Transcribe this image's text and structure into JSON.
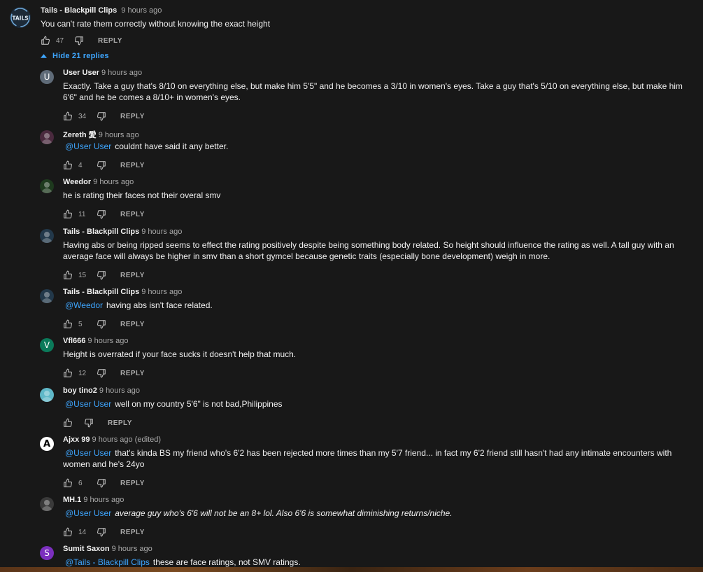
{
  "top_comment": {
    "author": "Tails - Blackpill Clips",
    "time": "9 hours ago",
    "text": "You can't rate them correctly without knowing the exact height",
    "likes": "47",
    "reply_label": "REPLY"
  },
  "hide_replies_label": "Hide 21 replies",
  "replies": [
    {
      "author": "User User",
      "time": "9 hours ago",
      "avatar_letter": "U",
      "avatar_color": "#5f6b78",
      "mention": "",
      "text": "Exactly. Take a guy that's 8/10 on everything else, but make him 5'5\" and he becomes a 3/10 in women's eyes. Take a guy that's 5/10 on everything else, but make him 6'6\" and he be comes a 8/10+ in women's eyes.",
      "likes": "34",
      "reply_label": "REPLY"
    },
    {
      "author": "Zereth 愛",
      "time": "9 hours ago",
      "avatar_letter": "",
      "avatar_color": "#4a2a3e",
      "mention": "@User User",
      "text": "couldnt have said it any better.",
      "likes": "4",
      "reply_label": "REPLY"
    },
    {
      "author": "Weedor",
      "time": "9 hours ago",
      "avatar_letter": "",
      "avatar_color": "#1e3a1e",
      "mention": "",
      "text": "he is rating their faces not their overal smv",
      "likes": "11",
      "reply_label": "REPLY"
    },
    {
      "author": "Tails - Blackpill Clips",
      "time": "9 hours ago",
      "avatar_letter": "",
      "avatar_color": "#22384a",
      "mention": "",
      "text": "Having abs or being ripped seems to effect the rating positively despite being something body related. So height should influence the rating as well. A tall guy with an average face will always be higher in smv than a short gymcel because genetic traits (especially bone development) weigh in more.",
      "likes": "15",
      "reply_label": "REPLY"
    },
    {
      "author": "Tails - Blackpill Clips",
      "time": "9 hours ago",
      "avatar_letter": "",
      "avatar_color": "#22384a",
      "mention": "@Weedor",
      "text": "having abs isn't face related.",
      "likes": "5",
      "reply_label": "REPLY"
    },
    {
      "author": "Vfl666",
      "time": "9 hours ago",
      "avatar_letter": "V",
      "avatar_color": "#0b7a5a",
      "mention": "",
      "text": "Height is overrated if your face sucks it doesn't help that much.",
      "likes": "12",
      "reply_label": "REPLY"
    },
    {
      "author": "boy tino2",
      "time": "9 hours ago",
      "avatar_letter": "",
      "avatar_color": "#5fb8c8",
      "mention": "@User User",
      "text": "well on my country 5'6\" is not bad,Philippines",
      "likes": "",
      "reply_label": "REPLY"
    },
    {
      "author": "Ajxx 99",
      "time": "9 hours ago (edited)",
      "avatar_letter": "A",
      "avatar_color": "#ffffff",
      "mention": "@User User",
      "text": "that's kinda BS my friend who's 6'2 has been rejected more times than my 5'7 friend... in fact my 6'2 friend still hasn't had any intimate encounters with women and he's 24yo",
      "likes": "6",
      "reply_label": "REPLY"
    },
    {
      "author": "MH.1",
      "time": "9 hours ago",
      "avatar_letter": "",
      "avatar_color": "#3a3a3a",
      "mention": "@User User",
      "text": "average guy who's 6'6 will not be an 8+ lol. Also 6'6 is somewhat diminishing returns/niche.",
      "likes": "14",
      "reply_label": "REPLY"
    },
    {
      "author": "Sumit Saxon",
      "time": "9 hours ago",
      "avatar_letter": "S",
      "avatar_color": "#7b2fbe",
      "mention": "@Tails - Blackpill Clips",
      "text": "these are face ratings, not SMV ratings.",
      "likes": "",
      "reply_label": ""
    }
  ]
}
